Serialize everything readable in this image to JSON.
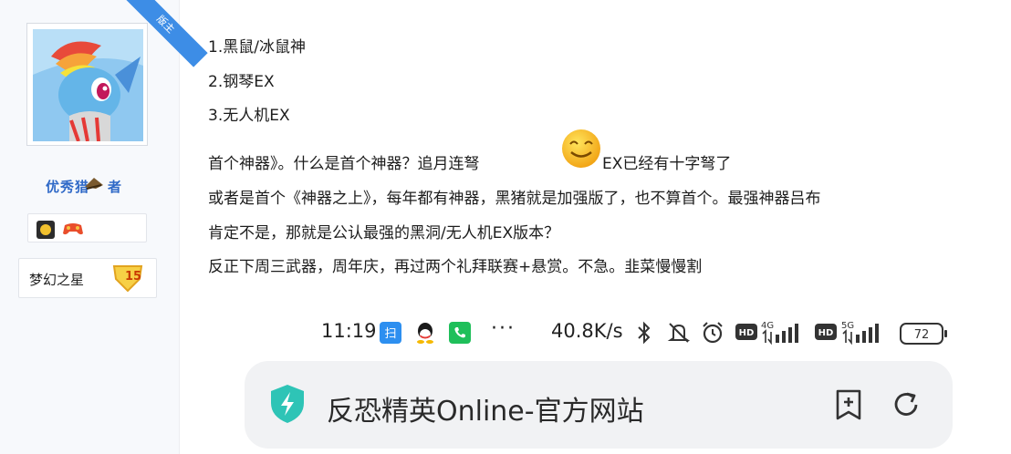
{
  "user": {
    "role_badge": "版主",
    "username": "优秀猎",
    "username_suffix": "者",
    "rank_title": "梦幻之星",
    "rank_level": "15"
  },
  "post": {
    "list": [
      "1.黑鼠/冰鼠神",
      "2.钢琴EX",
      "3.无人机EX"
    ],
    "para1_before": "首个神器》。什么是首个神器？追月连弩",
    "para1_after": "EX已经有十字弩了",
    "para2": "或者是首个《神器之上》，每年都有神器，黑猪就是加强版了，也不算首个。最强神器吕布",
    "para3": "肯定不是，那就是公认最强的黑洞/无人机EX版本？",
    "para4": "反正下周三武器，周年庆，再过两个礼拜联赛+悬赏。不急。韭菜慢慢割"
  },
  "status_bar": {
    "time": "11:19",
    "dots": "···",
    "net_speed": "40.8K/s",
    "net1": "4G",
    "net2": "5G",
    "hd_label": "HD",
    "battery": "72"
  },
  "address_bar": {
    "title": "反恐精英Online-官方网站"
  },
  "colors": {
    "accent_blue": "#3d8de6",
    "username_blue": "#2f69c7",
    "shield_teal": "#2ec4b6",
    "address_bg": "#f1f2f4"
  },
  "icons": [
    "shield-icon",
    "add-bookmark-icon",
    "reload-icon",
    "bluetooth-icon",
    "mute-icon",
    "alarm-icon",
    "signal-icon",
    "battery-icon",
    "qq-icon",
    "phone-icon",
    "alipay-icon",
    "smiley-emoji-icon"
  ]
}
